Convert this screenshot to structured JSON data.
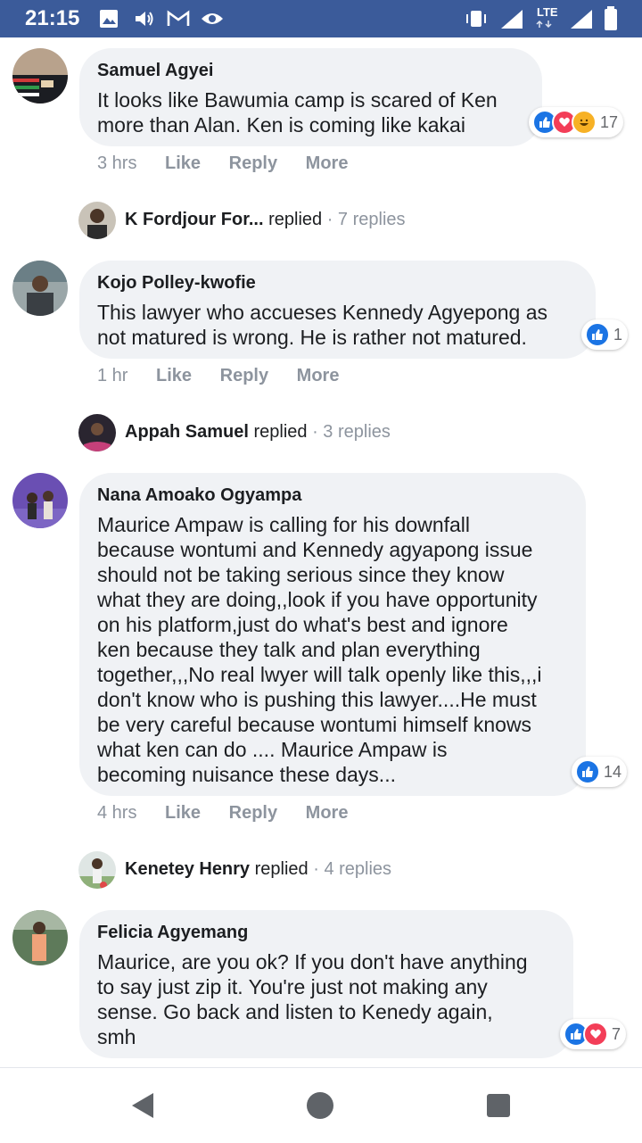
{
  "status_bar": {
    "time": "21:15",
    "network": "LTE"
  },
  "comments": [
    {
      "author": "Samuel Agyei",
      "lines": [
        "It looks like Bawumia camp is scared of Ken",
        "more than Alan. Ken is coming like kakai"
      ],
      "time": "3 hrs",
      "reaction_count": "17",
      "reactions": [
        "like",
        "love",
        "haha"
      ]
    },
    {
      "author": "Kojo Polley-kwofie",
      "lines": [
        "This lawyer who accueses Kennedy Agyepong as",
        "not matured is wrong. He is rather not matured."
      ],
      "time": "1 hr",
      "reaction_count": "1",
      "reactions": [
        "like"
      ]
    },
    {
      "author": "Nana Amoako Ogyampa",
      "lines": [
        "Maurice Ampaw is calling for his downfall",
        "because wontumi and Kennedy agyapong issue",
        "should not be taking serious since they know",
        "what they are doing,,look if you have opportunity",
        "on his platform,just do what's best and ignore",
        "ken because they talk and plan everything",
        "together,,,No real lwyer will talk openly like this,,,i",
        "don't know who is pushing this lawyer....He must",
        "be very careful because wontumi himself knows",
        "what ken can do .... Maurice Ampaw is",
        "becoming nuisance these days..."
      ],
      "time": "4 hrs",
      "reaction_count": "14",
      "reactions": [
        "like"
      ]
    },
    {
      "author": "Felicia Agyemang",
      "lines": [
        "Maurice, are you ok? If you don't have anything",
        "to say just zip it. You're just not making any",
        "sense. Go back and listen to Kenedy again,",
        "smh"
      ],
      "time": "",
      "reaction_count": "7",
      "reactions": [
        "like",
        "love"
      ]
    }
  ],
  "actions": {
    "like": "Like",
    "reply": "Reply",
    "more": "More"
  },
  "reply_threads": [
    {
      "name": "K Fordjour For...",
      "verb": "replied",
      "count": "· 7 replies"
    },
    {
      "name": "Appah Samuel",
      "verb": "replied",
      "count": "· 3 replies"
    },
    {
      "name": "Kenetey Henry",
      "verb": "replied",
      "count": "· 4 replies"
    }
  ],
  "colors": {
    "status_bar": "#3b5b9a",
    "bubble": "#f0f2f5",
    "like": "#1b74e4",
    "love": "#f33e58",
    "haha": "#f7b125",
    "meta_text": "#8d949e"
  }
}
